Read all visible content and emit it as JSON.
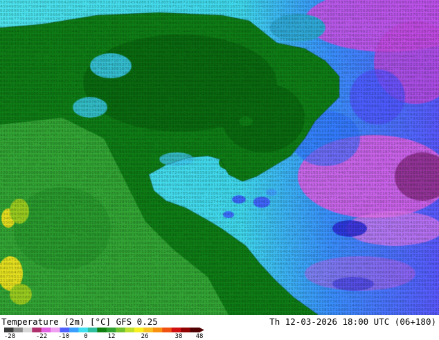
{
  "map": {
    "product": "Temperature (2m) [°C]",
    "model": "GFS 0.25",
    "valid_time": "Th 12-03-2026 18:00 UTC (06+180)"
  },
  "colorbar": {
    "ticks": [
      "-28",
      "-22",
      "-10",
      "0",
      "12",
      "26",
      "38",
      "48"
    ],
    "colors": [
      "#3a3a3a",
      "#8c8c8c",
      "#d8d8d8",
      "#b0306e",
      "#e060e0",
      "#f0a0f0",
      "#5060ff",
      "#3aa0ff",
      "#40e0f0",
      "#30c0a0",
      "#108010",
      "#30a030",
      "#70c030",
      "#c0e030",
      "#f8f020",
      "#f8c020",
      "#f89010",
      "#f05010",
      "#d01010",
      "#900000",
      "#500000"
    ]
  }
}
